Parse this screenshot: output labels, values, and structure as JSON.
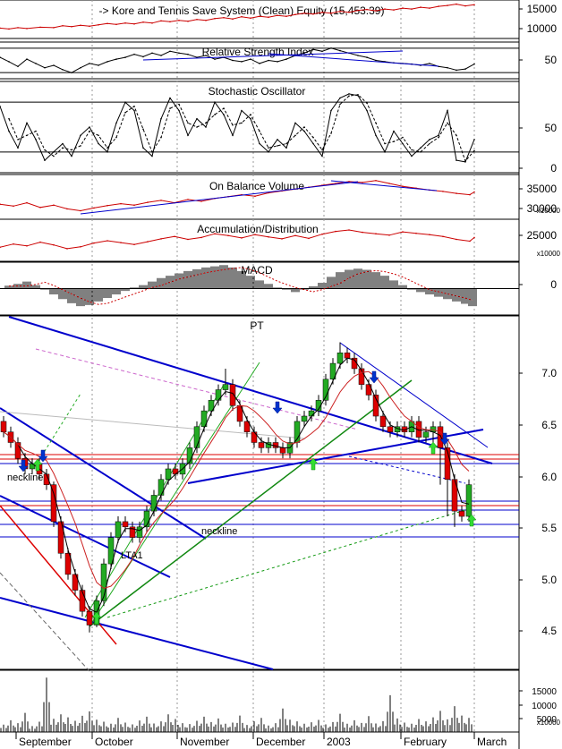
{
  "colors": {
    "equity": "#cc0000",
    "rsi": "#000000",
    "trend": "#0000cc",
    "up": "#22aa22",
    "down": "#dd0000",
    "obv": "#cc0000",
    "ad": "#cc0000",
    "macd_hist": "#000000",
    "macd_signal": "#cc0000",
    "grid": "#9a9a9a",
    "buy_arrow": "#33dd33",
    "sell_arrow": "#0033cc"
  },
  "chart_data": [
    {
      "type": "line",
      "panel": "equity",
      "title": "-> Kore and Tennis Save System (Clean) Equity (15,453.39)",
      "yticks": [
        "15000",
        "10000"
      ],
      "series": [
        {
          "x": [
            0,
            10,
            20,
            30,
            45,
            60,
            70,
            80,
            90,
            100,
            110,
            120,
            130,
            140,
            150,
            160,
            170,
            180,
            190,
            200,
            210,
            220,
            230,
            240,
            250,
            260,
            270,
            280,
            290,
            300,
            310,
            320,
            330,
            340,
            350,
            360,
            370,
            380,
            390,
            400,
            410,
            420,
            430,
            440,
            450,
            460,
            470,
            480,
            490,
            500,
            510,
            520,
            530
          ],
          "values": [
            10300,
            10100,
            10400,
            10200,
            10500,
            10400,
            10800,
            10600,
            10900,
            10700,
            11000,
            11300,
            11100,
            11400,
            11200,
            11600,
            11400,
            11900,
            11700,
            12000,
            11800,
            12200,
            12000,
            12400,
            12600,
            12300,
            12800,
            12500,
            12900,
            12700,
            13100,
            12900,
            13300,
            13600,
            13400,
            13800,
            13600,
            14000,
            13800,
            14200,
            14400,
            14100,
            14500,
            14300,
            14700,
            14500,
            14900,
            14700,
            15100,
            15300,
            15600,
            15200,
            15450
          ]
        }
      ]
    },
    {
      "type": "line",
      "panel": "rsi",
      "title": "Relative Strength Index",
      "yticks": [
        "50"
      ],
      "levels": [
        70,
        30
      ],
      "series": [
        {
          "x": [
            0,
            10,
            20,
            30,
            40,
            50,
            60,
            70,
            80,
            90,
            100,
            110,
            120,
            130,
            140,
            150,
            160,
            170,
            180,
            190,
            200,
            210,
            220,
            230,
            240,
            250,
            260,
            270,
            280,
            290,
            300,
            310,
            320,
            330,
            340,
            350,
            360,
            370,
            380,
            390,
            400,
            410,
            420,
            430,
            440,
            450,
            460,
            470,
            480,
            490,
            500,
            510,
            520,
            530
          ],
          "values": [
            55,
            48,
            40,
            52,
            45,
            38,
            42,
            35,
            30,
            38,
            45,
            42,
            48,
            52,
            55,
            60,
            56,
            62,
            58,
            65,
            62,
            60,
            55,
            58,
            52,
            55,
            50,
            48,
            52,
            45,
            50,
            48,
            52,
            58,
            62,
            68,
            65,
            70,
            66,
            62,
            58,
            55,
            50,
            48,
            46,
            45,
            44,
            42,
            45,
            40,
            38,
            34,
            36,
            44
          ]
        }
      ]
    },
    {
      "type": "line",
      "panel": "stochastic",
      "title": "Stochastic Oscillator",
      "yticks": [
        "50",
        "0"
      ],
      "levels": [
        80,
        20
      ],
      "series": [
        {
          "x": [
            0,
            10,
            20,
            30,
            40,
            50,
            60,
            70,
            80,
            90,
            100,
            110,
            120,
            130,
            140,
            150,
            160,
            170,
            180,
            190,
            200,
            210,
            220,
            230,
            240,
            250,
            260,
            270,
            280,
            290,
            300,
            310,
            320,
            330,
            340,
            350,
            360,
            370,
            380,
            390,
            400,
            410,
            420,
            430,
            440,
            450,
            460,
            470,
            480,
            490,
            500,
            510,
            520,
            530
          ],
          "values": [
            75,
            45,
            25,
            55,
            35,
            10,
            20,
            30,
            15,
            40,
            50,
            30,
            20,
            55,
            80,
            70,
            25,
            15,
            60,
            85,
            70,
            40,
            60,
            50,
            80,
            65,
            40,
            70,
            60,
            30,
            20,
            35,
            25,
            55,
            45,
            30,
            15,
            70,
            85,
            90,
            88,
            70,
            40,
            20,
            45,
            30,
            15,
            25,
            35,
            40,
            70,
            10,
            8,
            35
          ]
        }
      ]
    },
    {
      "type": "line",
      "panel": "obv",
      "title": "On Balance Volume",
      "yticks": [
        "35000",
        "30000"
      ],
      "unit": "x10000",
      "series": [
        {
          "x": [
            0,
            15,
            30,
            45,
            60,
            75,
            90,
            105,
            120,
            135,
            150,
            165,
            180,
            195,
            210,
            225,
            240,
            255,
            270,
            285,
            300,
            315,
            330,
            345,
            360,
            375,
            390,
            405,
            420,
            435,
            450,
            465,
            480,
            495,
            510,
            525,
            530
          ],
          "values": [
            31200,
            30800,
            31500,
            30500,
            31000,
            30200,
            29800,
            30400,
            30900,
            31300,
            31000,
            31600,
            32000,
            31500,
            32200,
            31800,
            32400,
            32800,
            33200,
            32900,
            33600,
            34000,
            34400,
            34800,
            35200,
            35600,
            36000,
            35800,
            36200,
            35600,
            35000,
            34600,
            34200,
            33900,
            33500,
            33200,
            33800
          ]
        }
      ]
    },
    {
      "type": "line",
      "panel": "ad",
      "title": "Accumulation/Distribution",
      "yticks": [
        "25000"
      ],
      "unit": "x10000",
      "series": [
        {
          "x": [
            0,
            15,
            30,
            45,
            60,
            75,
            90,
            105,
            120,
            135,
            150,
            165,
            180,
            195,
            210,
            225,
            240,
            255,
            270,
            285,
            300,
            315,
            330,
            345,
            360,
            375,
            390,
            405,
            420,
            435,
            450,
            465,
            480,
            495,
            510,
            525,
            530
          ],
          "values": [
            23500,
            24200,
            23800,
            24600,
            24000,
            23200,
            23600,
            24400,
            24900,
            24500,
            24100,
            24700,
            25300,
            25800,
            25200,
            25600,
            26400,
            26000,
            25500,
            26200,
            25700,
            25300,
            26000,
            25400,
            26300,
            26900,
            27200,
            26700,
            26400,
            26100,
            26800,
            26500,
            26200,
            25800,
            25200,
            24800,
            25600
          ]
        }
      ]
    },
    {
      "type": "bar",
      "panel": "macd",
      "title": "MACD",
      "yticks": [
        "0"
      ],
      "series": [
        {
          "x": [
            10,
            20,
            30,
            40,
            50,
            60,
            70,
            80,
            90,
            100,
            110,
            120,
            130,
            140,
            150,
            160,
            170,
            180,
            190,
            200,
            210,
            220,
            230,
            240,
            250,
            260,
            270,
            280,
            290,
            300,
            310,
            320,
            330,
            340,
            350,
            360,
            370,
            380,
            390,
            400,
            410,
            420,
            430,
            440,
            450,
            460,
            470,
            480,
            490,
            500,
            510,
            520,
            528
          ],
          "values": [
            0.05,
            0.08,
            0.12,
            0.06,
            -0.02,
            -0.1,
            -0.18,
            -0.25,
            -0.3,
            -0.28,
            -0.22,
            -0.16,
            -0.1,
            -0.04,
            0.02,
            0.06,
            0.12,
            0.18,
            0.22,
            0.26,
            0.3,
            0.33,
            0.36,
            0.38,
            0.4,
            0.36,
            0.3,
            0.22,
            0.14,
            0.08,
            0.02,
            -0.02,
            -0.06,
            -0.02,
            0.04,
            0.1,
            0.2,
            0.28,
            0.32,
            0.34,
            0.32,
            0.28,
            0.22,
            0.14,
            0.06,
            -0.02,
            -0.06,
            -0.1,
            -0.14,
            -0.18,
            -0.22,
            -0.26,
            -0.3
          ]
        }
      ]
    },
    {
      "type": "candlestick",
      "panel": "price",
      "title": "PT",
      "yticks": [
        "7.0",
        "6.5",
        "6.0",
        "5.5",
        "5.0",
        "4.5"
      ],
      "x": [
        4,
        12,
        20,
        28,
        36,
        44,
        52,
        60,
        68,
        76,
        84,
        92,
        100,
        108,
        116,
        124,
        132,
        140,
        148,
        156,
        164,
        172,
        180,
        188,
        196,
        204,
        212,
        220,
        228,
        236,
        244,
        252,
        260,
        268,
        276,
        284,
        292,
        300,
        308,
        316,
        324,
        332,
        340,
        348,
        356,
        364,
        372,
        380,
        388,
        396,
        404,
        412,
        420,
        428,
        436,
        444,
        452,
        460,
        468,
        476,
        484,
        492,
        500,
        508,
        516,
        524
      ],
      "open": [
        6.55,
        6.45,
        6.35,
        6.2,
        6.1,
        6.15,
        6.05,
        5.95,
        5.6,
        5.3,
        5.1,
        4.95,
        4.75,
        4.62,
        4.85,
        5.2,
        5.45,
        5.6,
        5.55,
        5.45,
        5.55,
        5.7,
        5.85,
        6.0,
        6.1,
        6.05,
        6.15,
        6.3,
        6.5,
        6.65,
        6.75,
        6.85,
        6.9,
        6.7,
        6.55,
        6.45,
        6.35,
        6.3,
        6.35,
        6.3,
        6.25,
        6.35,
        6.55,
        6.6,
        6.65,
        6.75,
        6.95,
        7.1,
        7.2,
        7.15,
        7.05,
        6.9,
        6.8,
        6.6,
        6.5,
        6.45,
        6.5,
        6.45,
        6.55,
        6.4,
        6.45,
        6.5,
        6.3,
        6.0,
        5.7,
        5.65
      ],
      "close": [
        6.45,
        6.35,
        6.2,
        6.1,
        6.15,
        6.05,
        5.95,
        5.6,
        5.3,
        5.1,
        4.95,
        4.75,
        4.62,
        4.85,
        5.2,
        5.45,
        5.6,
        5.55,
        5.45,
        5.55,
        5.7,
        5.85,
        6.0,
        6.1,
        6.05,
        6.15,
        6.3,
        6.5,
        6.65,
        6.75,
        6.85,
        6.9,
        6.7,
        6.55,
        6.45,
        6.35,
        6.3,
        6.35,
        6.3,
        6.25,
        6.35,
        6.55,
        6.6,
        6.65,
        6.75,
        6.95,
        7.1,
        7.2,
        7.15,
        7.05,
        6.9,
        6.8,
        6.6,
        6.5,
        6.45,
        6.5,
        6.45,
        6.55,
        6.4,
        6.45,
        6.5,
        6.3,
        6.0,
        5.7,
        5.65,
        5.95
      ],
      "high": [
        6.6,
        6.5,
        6.4,
        6.25,
        6.2,
        6.2,
        6.1,
        5.98,
        5.65,
        5.35,
        5.15,
        5.0,
        4.8,
        4.9,
        5.25,
        5.5,
        5.65,
        5.65,
        5.6,
        5.6,
        5.75,
        5.9,
        6.05,
        6.15,
        6.15,
        6.2,
        6.35,
        6.55,
        6.7,
        6.8,
        6.9,
        7.05,
        6.95,
        6.75,
        6.6,
        6.5,
        6.4,
        6.4,
        6.4,
        6.35,
        6.4,
        6.6,
        6.65,
        6.7,
        6.8,
        7.0,
        7.15,
        7.3,
        7.25,
        7.2,
        7.1,
        6.95,
        6.85,
        6.65,
        6.55,
        6.55,
        6.55,
        6.6,
        6.6,
        6.5,
        6.55,
        6.55,
        6.35,
        6.05,
        5.75,
        6.0
      ],
      "low": [
        6.4,
        6.3,
        6.15,
        6.05,
        6.05,
        6.0,
        5.9,
        5.55,
        5.25,
        5.05,
        4.9,
        4.7,
        4.55,
        4.6,
        4.8,
        5.15,
        5.4,
        5.5,
        5.4,
        5.4,
        5.5,
        5.65,
        5.8,
        5.95,
        6.0,
        6.0,
        6.1,
        6.25,
        6.45,
        6.6,
        6.7,
        6.8,
        6.65,
        6.5,
        6.4,
        6.3,
        6.25,
        6.25,
        6.25,
        6.2,
        6.2,
        6.3,
        6.5,
        6.55,
        6.6,
        6.7,
        6.9,
        7.05,
        7.1,
        7.0,
        6.85,
        6.75,
        6.55,
        6.45,
        6.4,
        6.4,
        6.4,
        6.4,
        6.35,
        6.35,
        6.25,
        5.95,
        5.65,
        5.55,
        5.6,
        5.6
      ],
      "annotations": [
        "neckline",
        "neckline",
        "LTA1"
      ]
    },
    {
      "type": "bar",
      "panel": "volume",
      "yticks": [
        "15000",
        "10000",
        "5000"
      ],
      "unit": "x10000",
      "series": [
        {
          "x": [
            4,
            12,
            20,
            28,
            36,
            44,
            52,
            60,
            68,
            76,
            84,
            92,
            100,
            108,
            116,
            124,
            132,
            140,
            148,
            156,
            164,
            172,
            180,
            188,
            196,
            204,
            212,
            220,
            228,
            236,
            244,
            252,
            260,
            268,
            276,
            284,
            292,
            300,
            308,
            316,
            324,
            332,
            340,
            348,
            356,
            364,
            372,
            380,
            388,
            396,
            404,
            412,
            420,
            428,
            436,
            444,
            452,
            460,
            468,
            476,
            484,
            492,
            500,
            508,
            516,
            524
          ],
          "values": [
            2500,
            4000,
            3000,
            6500,
            2000,
            3500,
            18500,
            4500,
            6000,
            5000,
            3800,
            5500,
            7000,
            4200,
            3500,
            2800,
            4800,
            3200,
            2600,
            3900,
            5200,
            2900,
            3600,
            6000,
            4400,
            3000,
            2700,
            3800,
            5200,
            3400,
            4600,
            2800,
            3200,
            5600,
            2400,
            3600,
            4800,
            2200,
            3000,
            8000,
            4200,
            3600,
            2800,
            3300,
            4100,
            2600,
            3400,
            6200,
            2800,
            4000,
            3100,
            5400,
            2900,
            3700,
            12500,
            4600,
            3200,
            2800,
            4400,
            3600,
            5000,
            7200,
            4300,
            8800,
            5600,
            4800
          ]
        }
      ]
    },
    {
      "type": "axis",
      "panel": "time",
      "categories": [
        "September",
        "October",
        "November",
        "December",
        "2003",
        "February",
        "March"
      ],
      "x": [
        18,
        103,
        198,
        283,
        362,
        448,
        530
      ]
    }
  ]
}
